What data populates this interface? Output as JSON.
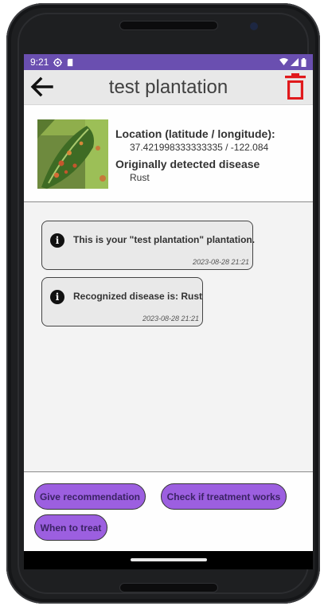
{
  "status_bar": {
    "time": "9:21"
  },
  "app_bar": {
    "title": "test plantation"
  },
  "plantation": {
    "location_label": "Location (latitude / longitude):",
    "location_value": "37.421998333333335 / -122.084",
    "disease_label": "Originally detected disease",
    "disease_value": "Rust"
  },
  "messages": [
    {
      "text": "This is your \"test plantation\" plantation.",
      "timestamp": "2023-08-28 21:21",
      "icon": "info-icon"
    },
    {
      "text": "Recognized disease is: Rust",
      "timestamp": "2023-08-28 21:21",
      "icon": "info-icon"
    }
  ],
  "actions": {
    "give_recommendation": "Give recommendation",
    "check_treatment": "Check if treatment works",
    "when_to_treat": "When to treat"
  },
  "colors": {
    "status_bar": "#6a4fb0",
    "action_button": "#9c5fe0",
    "delete_icon": "#e0191c"
  }
}
